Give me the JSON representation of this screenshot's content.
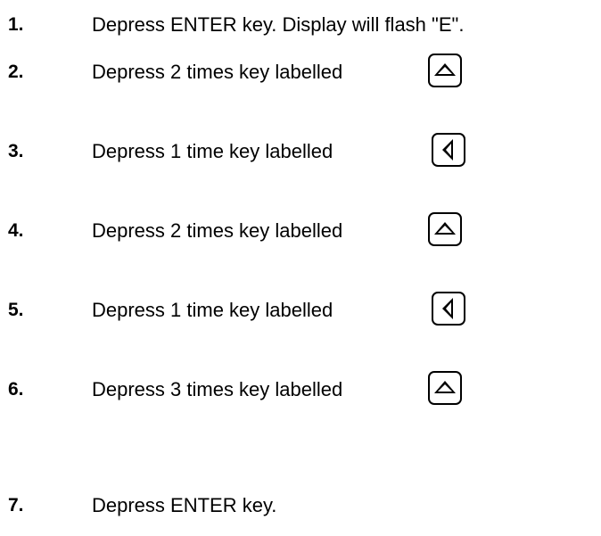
{
  "steps": [
    {
      "number": "1.",
      "text": "Depress ENTER key.  Display will flash \"E\".",
      "key_icon": ""
    },
    {
      "number": "2.",
      "text": "Depress 2 times key labelled",
      "key_icon": "up-arrow-key-icon"
    },
    {
      "number": "3.",
      "text": "Depress 1 time key labelled",
      "key_icon": "left-arrow-key-icon"
    },
    {
      "number": "4.",
      "text": "Depress 2 times key labelled",
      "key_icon": "up-arrow-key-icon"
    },
    {
      "number": "5.",
      "text": "Depress 1 time key labelled",
      "key_icon": "left-arrow-key-icon"
    },
    {
      "number": "6.",
      "text": "Depress 3 times key labelled",
      "key_icon": "up-arrow-key-icon"
    },
    {
      "number": "7.",
      "text": "Depress ENTER key.",
      "key_icon": ""
    }
  ]
}
